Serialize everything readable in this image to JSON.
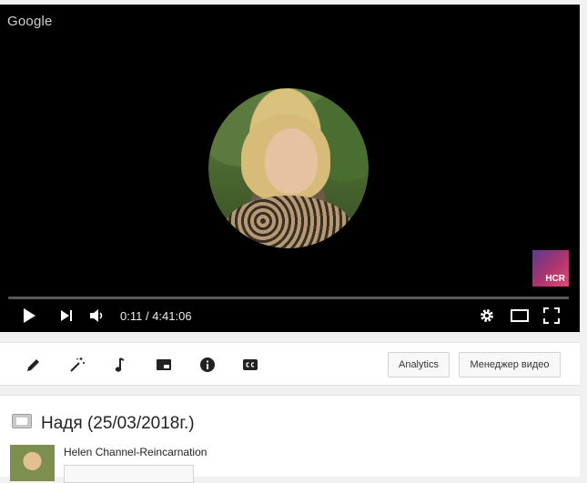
{
  "player": {
    "brand": "Google",
    "watermark_text": "HCR",
    "current_time": "0:11",
    "separator": " / ",
    "duration": "4:41:06",
    "progress_fraction": 0.0007
  },
  "toolbar": {
    "tools": [
      "pencil-icon",
      "magic-wand-icon",
      "music-note-icon",
      "card-icon",
      "info-icon",
      "cc-icon"
    ],
    "analytics_label": "Analytics",
    "manager_label": "Менеджер видео"
  },
  "video": {
    "title": "Надя (25/03/2018г.)",
    "channel_name": "Helen Channel-Reincarnation"
  },
  "colors": {
    "progress_played": "#cc181e",
    "player_bg": "#000000"
  }
}
